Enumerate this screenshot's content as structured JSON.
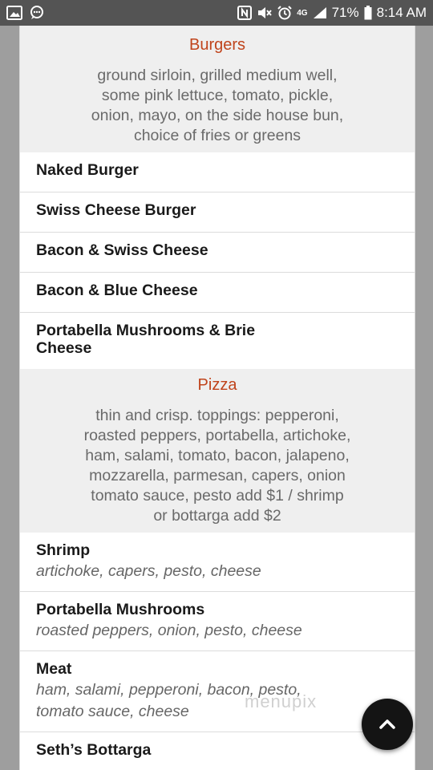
{
  "status_bar": {
    "battery_percent": "71%",
    "time": "8:14 AM",
    "left_icons": [
      "image-icon",
      "message-icon"
    ],
    "right_icons": [
      "nfc-icon",
      "mute-icon",
      "alarm-icon",
      "4g-icon",
      "signal-icon",
      "battery-icon"
    ],
    "network_label": "4G"
  },
  "sections": [
    {
      "title": "Burgers",
      "description_lines": [
        "ground sirloin, grilled medium well,",
        "some pink lettuce, tomato, pickle,",
        "onion, mayo, on the side house bun,",
        "choice of fries or greens"
      ],
      "items": [
        {
          "name": "Naked Burger"
        },
        {
          "name": "Swiss Cheese Burger"
        },
        {
          "name": "Bacon & Swiss Cheese"
        },
        {
          "name": "Bacon & Blue Cheese"
        },
        {
          "name_lines": [
            "Portabella Mushrooms & Brie",
            "Cheese"
          ]
        }
      ]
    },
    {
      "title": "Pizza",
      "description_lines": [
        "thin and crisp. toppings: pepperoni,",
        "roasted peppers, portabella, artichoke,",
        "ham, salami, tomato, bacon, jalapeno,",
        "mozzarella, parmesan, capers, onion",
        "tomato sauce, pesto add $1 / shrimp",
        "or bottarga add $2"
      ],
      "items": [
        {
          "name": "Shrimp",
          "desc_lines": [
            "artichoke, capers, pesto, cheese"
          ]
        },
        {
          "name": "Portabella Mushrooms",
          "desc_lines": [
            "roasted peppers, onion, pesto, cheese"
          ]
        },
        {
          "name": "Meat",
          "desc_lines": [
            "ham, salami, pepperoni, bacon, pesto,",
            "tomato sauce, cheese"
          ]
        },
        {
          "name": "Seth’s Bottarga"
        }
      ]
    }
  ],
  "watermark": "menupix",
  "scroll_top_button": {
    "icon": "chevron-up-icon"
  },
  "colors": {
    "section_title": "#c0441c",
    "section_bg": "#efefef",
    "status_bar_bg": "#545454",
    "fab_bg": "#141414"
  }
}
